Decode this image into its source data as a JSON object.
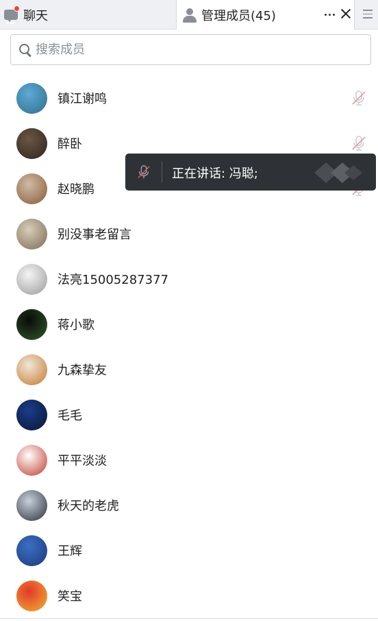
{
  "tabs": {
    "chat_label": "聊天",
    "members_label": "管理成员(45)"
  },
  "search": {
    "placeholder": "搜索成员"
  },
  "members": [
    {
      "name": "镇江谢鸣",
      "muted": true,
      "avatar_colors": [
        "#5ea9d6",
        "#2f6f8c"
      ]
    },
    {
      "name": "醉卧",
      "muted": true,
      "avatar_colors": [
        "#6b5544",
        "#2e2520"
      ]
    },
    {
      "name": "赵晓鹏",
      "muted": true,
      "avatar_colors": [
        "#cdbba3",
        "#8a5a3a"
      ]
    },
    {
      "name": "别没事老留言",
      "muted": false,
      "avatar_colors": [
        "#d9cdb8",
        "#7a6a55"
      ]
    },
    {
      "name": "法亮15005287377",
      "muted": false,
      "avatar_colors": [
        "#f4f4f4",
        "#9a9a9a"
      ]
    },
    {
      "name": "蒋小歌",
      "muted": false,
      "avatar_colors": [
        "#0a0a0a",
        "#2f5a2a"
      ]
    },
    {
      "name": "九森挚友",
      "muted": false,
      "avatar_colors": [
        "#f0e6d8",
        "#c47a2e"
      ]
    },
    {
      "name": "毛毛",
      "muted": false,
      "avatar_colors": [
        "#1a3d8a",
        "#0b1633"
      ]
    },
    {
      "name": "平平淡淡",
      "muted": false,
      "avatar_colors": [
        "#ffffff",
        "#c0392b"
      ]
    },
    {
      "name": "秋天的老虎",
      "muted": false,
      "avatar_colors": [
        "#c8d0dc",
        "#2b2f3a"
      ]
    },
    {
      "name": "王辉",
      "muted": false,
      "avatar_colors": [
        "#3a6fc4",
        "#1c3a78"
      ]
    },
    {
      "name": "笑宝",
      "muted": false,
      "avatar_colors": [
        "#e03a2a",
        "#f2b233"
      ]
    }
  ],
  "speaking_toast": {
    "text": "正在讲话: 冯聪;"
  },
  "colors": {
    "muted_slash": "#f08a8a",
    "toast_bg": "#2e3135",
    "badge": "#f0413a"
  },
  "icons": [
    "chat-icon",
    "person-icon",
    "more-icon",
    "close-icon",
    "menu-icon",
    "search-icon",
    "mic-muted-icon"
  ]
}
